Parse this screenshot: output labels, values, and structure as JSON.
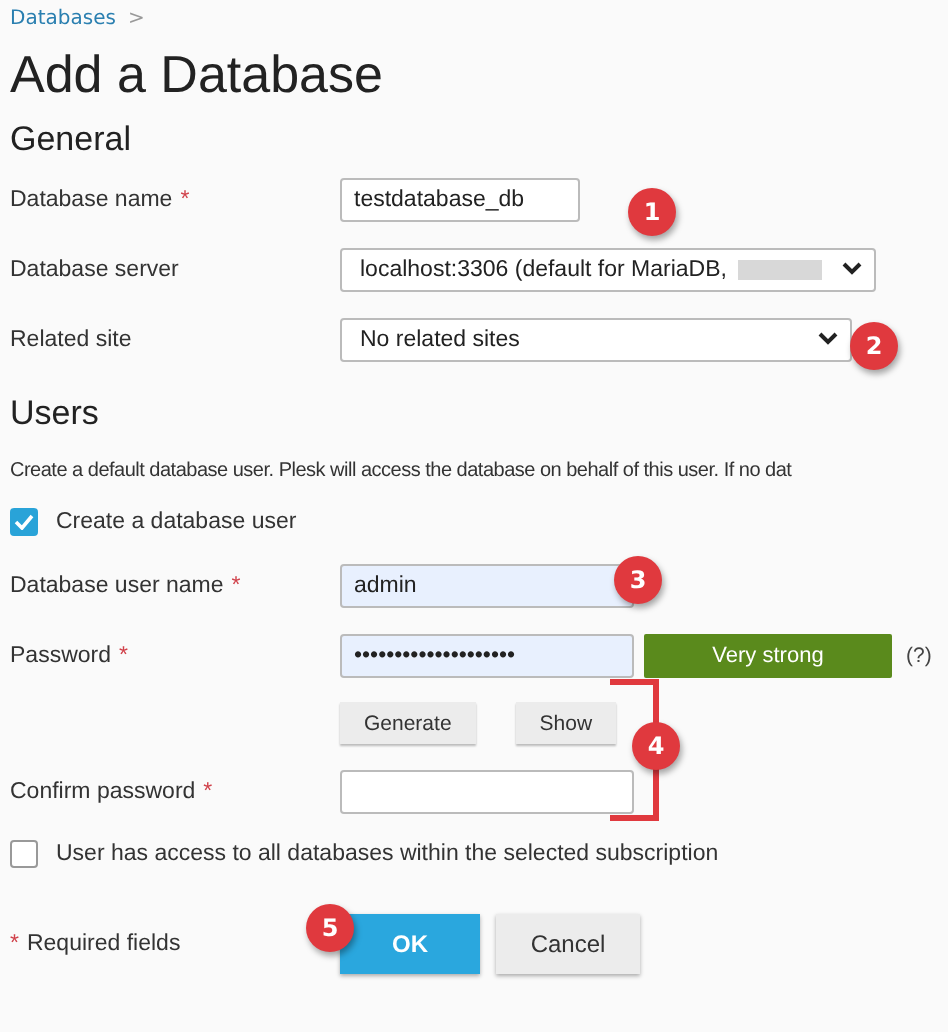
{
  "breadcrumb": {
    "link": "Databases",
    "separator": ">"
  },
  "title": "Add a Database",
  "general": {
    "heading": "General",
    "fields": [
      {
        "kind": "input",
        "label": "Database name",
        "required_mark": "*",
        "value": "testdatabase_db"
      },
      {
        "kind": "select",
        "label": "Database server",
        "value": "localhost:3306 (default for MariaDB,",
        "redacted": true
      },
      {
        "kind": "select",
        "label": "Related site",
        "value": "No related sites"
      }
    ]
  },
  "users": {
    "heading": "Users",
    "description": "Create a default database user. Plesk will access the database on behalf of this user. If no dat",
    "create_user": {
      "label": "Create a database user",
      "checked": true
    },
    "user_name": {
      "label": "Database user name",
      "required_mark": "*",
      "value": "admin",
      "autofill": true
    },
    "password": {
      "label": "Password",
      "required_mark": "*",
      "value": "••••••••••••••••••••",
      "autofill": true,
      "strength": "Very strong",
      "help": "(?)"
    },
    "password_buttons": [
      "Generate",
      "Show"
    ],
    "confirm": {
      "label": "Confirm password",
      "required_mark": "*"
    },
    "all_access": {
      "label": "User has access to all databases within the selected subscription",
      "checked": false
    }
  },
  "footer": {
    "required_mark": "*",
    "required_text": "Required fields",
    "buttons": [
      {
        "label": "OK",
        "primary": true
      },
      {
        "label": "Cancel",
        "primary": false
      }
    ]
  },
  "annotations": [
    {
      "label": "1"
    },
    {
      "label": "2"
    },
    {
      "label": "3"
    },
    {
      "label": "4"
    },
    {
      "label": "5"
    }
  ]
}
